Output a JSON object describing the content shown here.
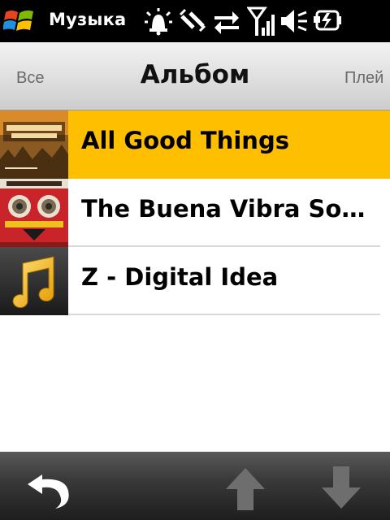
{
  "status_bar": {
    "app_title": "Музыка",
    "icons": [
      "windows-start-icon",
      "alarm-icon",
      "sync-icon",
      "data-transfer-icon",
      "signal-strength-icon",
      "volume-icon",
      "battery-charging-icon"
    ]
  },
  "header": {
    "prev_tab": "Все",
    "current_tab": "Альбом",
    "next_tab": "Плей"
  },
  "albums": [
    {
      "title": "All Good Things",
      "art": "pacha-massive-cover",
      "selected": true
    },
    {
      "title": "The Buena Vibra So…",
      "art": "sidestepper-cover",
      "selected": false
    },
    {
      "title": "Z - Digital Idea",
      "art": "music-note-icon",
      "selected": false
    }
  ],
  "toolbar": {
    "buttons": [
      "back-icon",
      "up-arrow-icon",
      "down-arrow-icon"
    ]
  },
  "colors": {
    "selection": "#fdbf00",
    "status_bar_bg": "#000000",
    "toolbar_bg": "#2e2e2e"
  }
}
